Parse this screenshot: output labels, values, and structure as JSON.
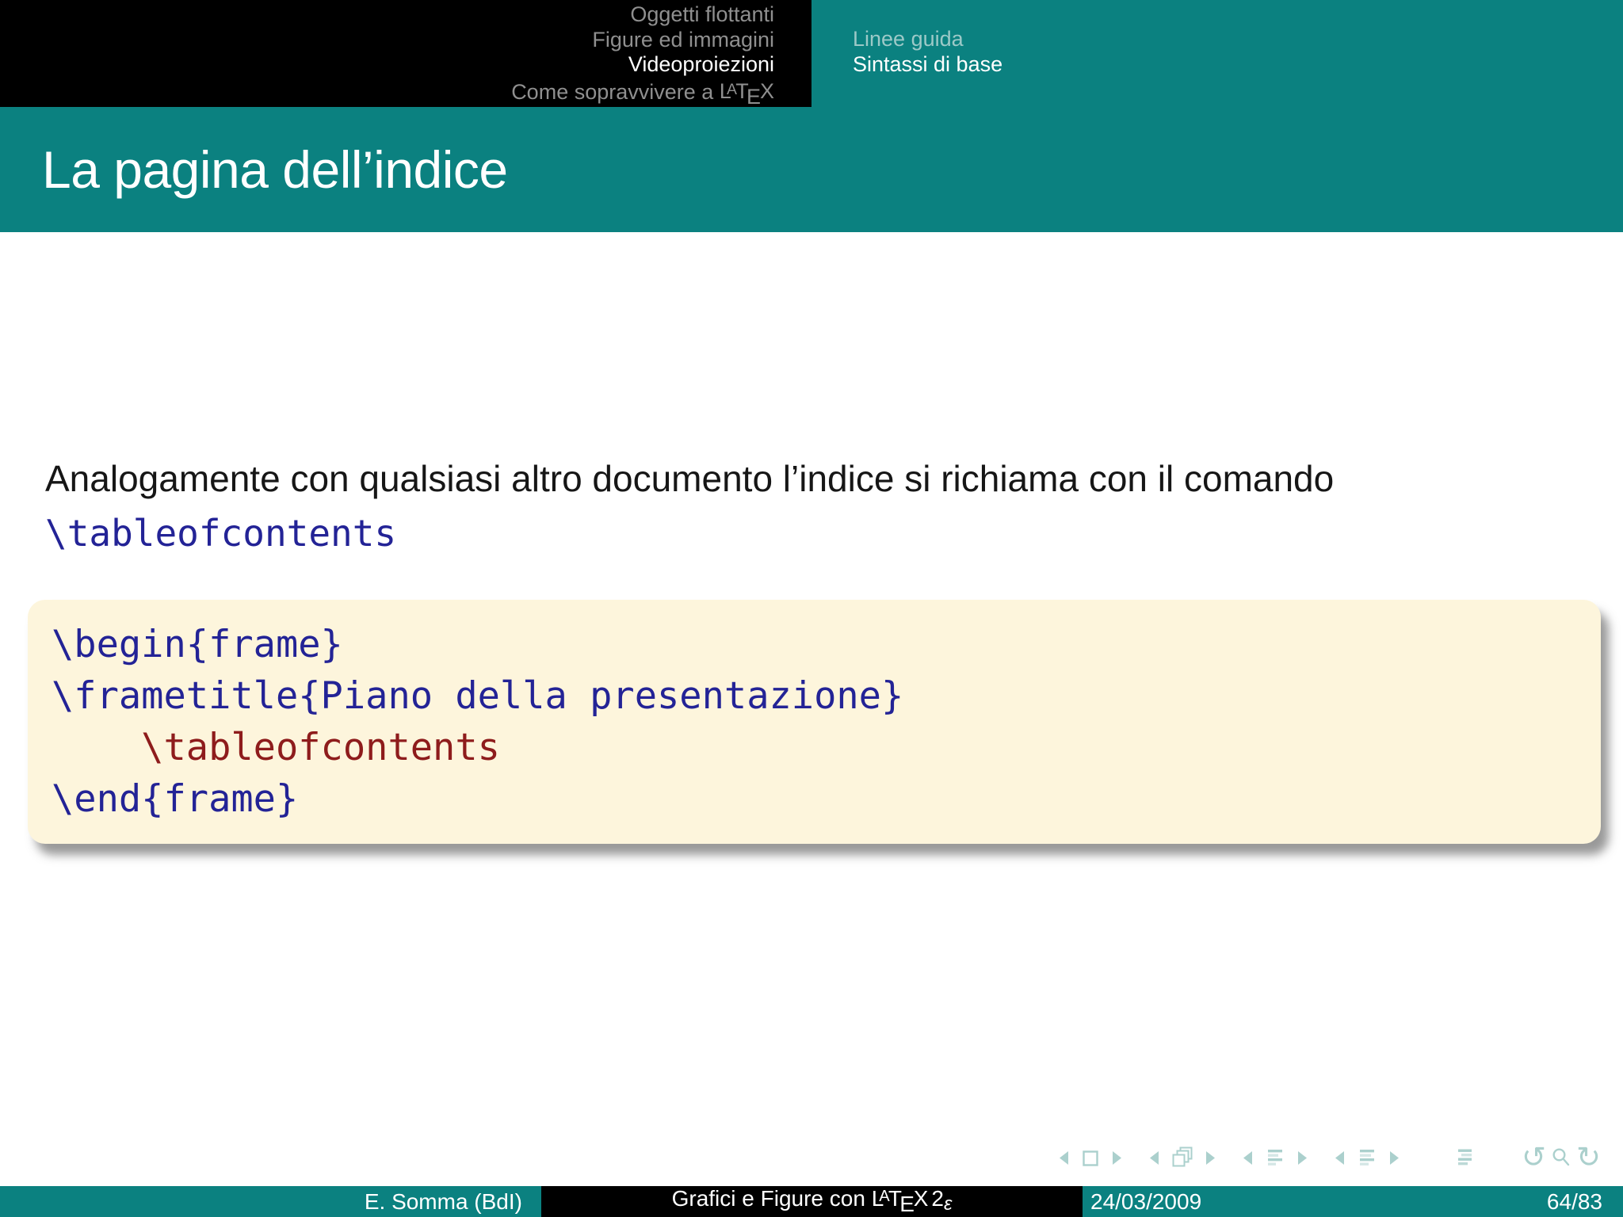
{
  "colors": {
    "teal": "#0b8180",
    "black": "#000000",
    "cream": "#fdf5dc",
    "code-blue": "#232396",
    "code-red": "#8e1c1c",
    "header-inactive": "#8f8f8f",
    "subsection-inactive": "#9cc9c7",
    "nav-icon": "#abd0cd",
    "text": "#161616",
    "white": "#ffffff"
  },
  "latex_logo": {
    "L": "L",
    "A": "A",
    "T": "T",
    "E": "E",
    "X": "X"
  },
  "header": {
    "sections": [
      {
        "label": "Oggetti flottanti"
      },
      {
        "label": "Figure ed immagini"
      },
      {
        "label": "Videoproiezioni"
      },
      {
        "label_prefix": "Come sopravvivere a "
      }
    ],
    "subsections": [
      {
        "label": "Linee guida"
      },
      {
        "label": "Sintassi di base"
      }
    ]
  },
  "frametitle": "La pagina dell’indice",
  "body": {
    "paragraph": "Analogamente con qualsiasi altro documento l’indice si richiama con il comando",
    "inline_command": "\\tableofcontents"
  },
  "code_block": {
    "lines": [
      {
        "text": "\\begin{frame}",
        "color": "blue"
      },
      {
        "text": "\\frametitle{Piano della presentazione}",
        "color": "blue"
      },
      {
        "text": "    \\tableofcontents",
        "color": "red"
      },
      {
        "text": "\\end{frame}",
        "color": "blue"
      }
    ]
  },
  "navigation": {
    "icons": [
      "slide-back-icon",
      "slide-icon",
      "slide-forward-icon",
      "frame-back-icon",
      "frames-icon",
      "frame-forward-icon",
      "subsection-back-icon",
      "subsection-icon",
      "subsection-forward-icon",
      "section-back-icon",
      "section-icon",
      "section-forward-icon",
      "presentation-icon",
      "history-back-icon",
      "search-icon",
      "history-forward-icon"
    ],
    "history_back_glyph": "↺",
    "history_forward_glyph": "↻"
  },
  "footer": {
    "author": "E. Somma (BdI)",
    "title_prefix": "Grafici e Figure con ",
    "version_num": "2",
    "version_eps": "ε",
    "date": "24/03/2009",
    "page": "64/83"
  }
}
